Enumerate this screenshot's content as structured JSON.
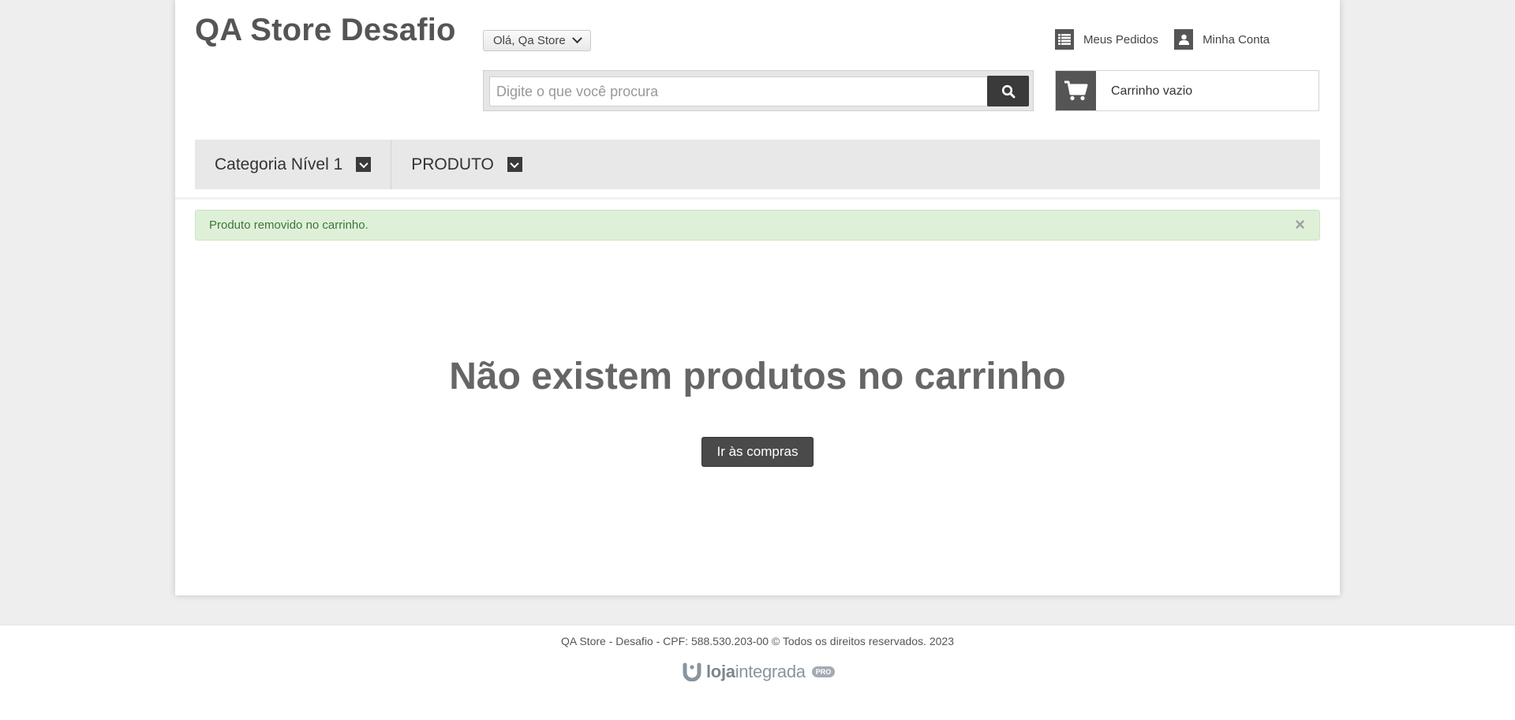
{
  "header": {
    "store_title": "QA Store Desafio",
    "greeting": "Olá, Qa Store",
    "links": [
      {
        "label": "Meus Pedidos",
        "icon": "list-icon"
      },
      {
        "label": "Minha Conta",
        "icon": "user-icon"
      }
    ],
    "search": {
      "placeholder": "Digite o que você procura",
      "value": "",
      "button_icon": "search-icon"
    },
    "cart": {
      "label": "Carrinho vazio",
      "icon": "cart-icon"
    }
  },
  "nav": {
    "items": [
      {
        "label": "Categoria Nível 1"
      },
      {
        "label": "PRODUTO"
      }
    ]
  },
  "alert": {
    "message": "Produto removido no carrinho.",
    "close": "×"
  },
  "main": {
    "empty_title": "Não existem produtos no carrinho",
    "shop_button": "Ir às compras"
  },
  "footer": {
    "text": "QA Store - Desafio - CPF: 588.530.203-00 © Todos os direitos reservados. 2023",
    "brand": {
      "name_bold": "loja",
      "name_rest": "integrada",
      "badge": "PRO"
    }
  },
  "colors": {
    "background": "#eeeeee",
    "dark_button": "#3a3a3a",
    "alert_bg": "#dff0d8",
    "alert_text": "#3c763d"
  }
}
